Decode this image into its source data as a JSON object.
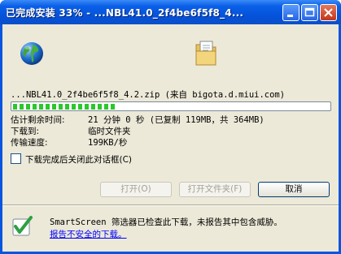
{
  "window": {
    "title": "已完成安装 33% - ...NBL41.0_2f4be6f5f8_4...",
    "controls": [
      "minimize-icon",
      "maximize-icon",
      "close-icon"
    ]
  },
  "header": {
    "source_icon": "globe-icon",
    "destination_icon": "folder-document-icon",
    "file_line": "...NBL41.0_2f4be6f5f8_4.2.zip (来自 bigota.d.miui.com)"
  },
  "progress": {
    "percent": 33,
    "color": "#2dc62d"
  },
  "info": [
    {
      "label": "估计剩余时间:",
      "value": "21 分钟 0 秒 (已复制 119MB，共 364MB)"
    },
    {
      "label": "下载到:",
      "value": "临时文件夹"
    },
    {
      "label": "传输速度:",
      "value": "199KB/秒"
    }
  ],
  "options": {
    "close_when_done_label": "下载完成后关闭此对话框(C)",
    "close_when_done_checked": false
  },
  "buttons": {
    "open": "打开(O)",
    "open_folder": "打开文件夹(F)",
    "cancel": "取消"
  },
  "footer": {
    "icon": "shield-check-icon",
    "message": "SmartScreen 筛选器已检查此下载，未报告其中包含威胁。",
    "link": "报告不安全的下载。"
  }
}
